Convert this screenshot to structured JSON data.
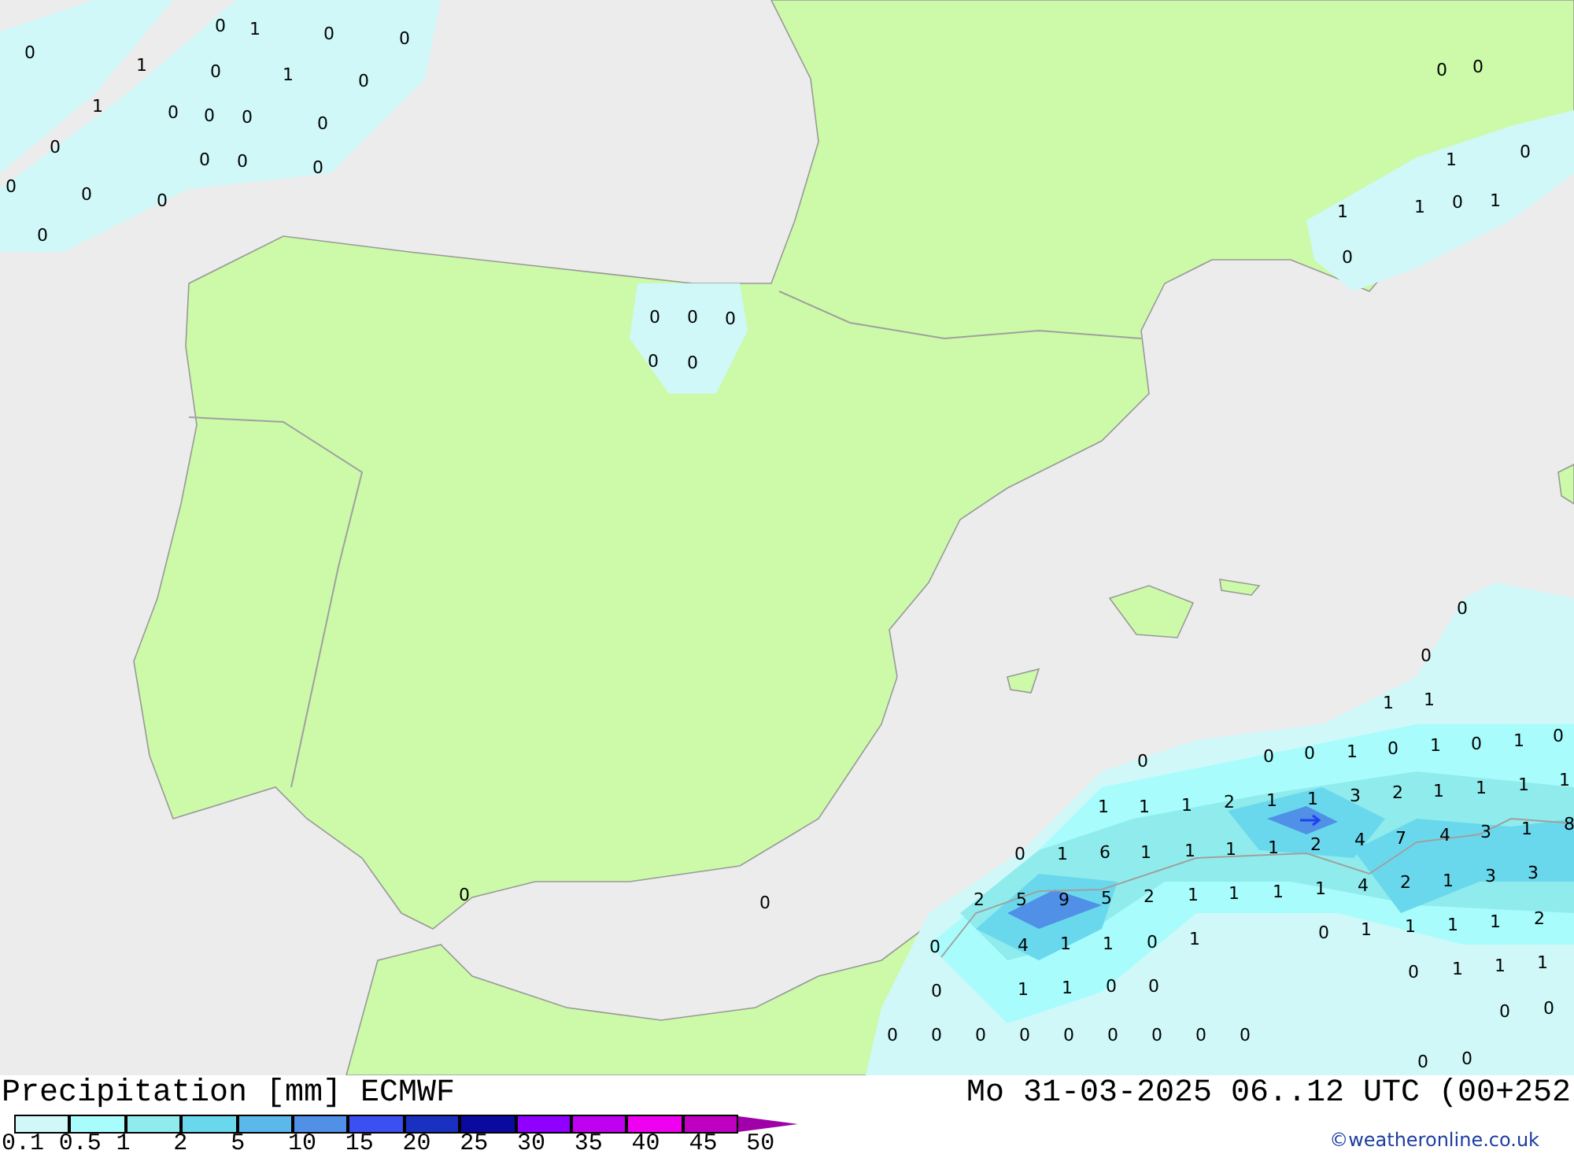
{
  "map": {
    "precipitation_labels": [
      "0",
      "0",
      "1",
      "0",
      "0",
      "1",
      "0",
      "1",
      "0",
      "1",
      "0",
      "0",
      "0",
      "0",
      "0",
      "0",
      "0",
      "0",
      "0",
      "0",
      "0",
      "0",
      "0",
      "0",
      "0",
      "0",
      "0",
      "0",
      "0",
      "1",
      "0",
      "1",
      "1",
      "0",
      "1",
      "0",
      "0",
      "0",
      "0",
      "0",
      "1",
      "1",
      "0",
      "0",
      "0",
      "1",
      "0",
      "1",
      "0",
      "1",
      "0",
      "1",
      "1",
      "1",
      "2",
      "1",
      "1",
      "3",
      "2",
      "1",
      "1",
      "1",
      "1",
      "0",
      "1",
      "6",
      "1",
      "1",
      "1",
      "1",
      "2",
      "4",
      "7",
      "4",
      "3",
      "1",
      "8",
      "2",
      "5",
      "9",
      "5",
      "2",
      "1",
      "1",
      "1",
      "1",
      "4",
      "2",
      "1",
      "3",
      "3",
      "0",
      "4",
      "1",
      "1",
      "0",
      "1",
      "0",
      "1",
      "1",
      "1",
      "1",
      "2",
      "0",
      "1",
      "1",
      "0",
      "0",
      "0",
      "1",
      "1",
      "1",
      "0",
      "0",
      "0",
      "0",
      "0",
      "0",
      "0",
      "0",
      "0",
      "0",
      "0",
      "0",
      "0"
    ]
  },
  "legend": {
    "title": "Precipitation [mm]",
    "model": "ECMWF",
    "bins": [
      {
        "kind": "box",
        "color": "#d0f8f8"
      },
      {
        "kind": "box",
        "color": "#a8fcfc"
      },
      {
        "kind": "box",
        "color": "#90ecec"
      },
      {
        "kind": "box",
        "color": "#6ad8ec"
      },
      {
        "kind": "box",
        "color": "#5ab8ea"
      },
      {
        "kind": "box",
        "color": "#5090e6"
      },
      {
        "kind": "box",
        "color": "#3a50f0"
      },
      {
        "kind": "box",
        "color": "#1a30c0"
      },
      {
        "kind": "box",
        "color": "#0a0aa0"
      },
      {
        "kind": "box",
        "color": "#9000ff"
      },
      {
        "kind": "box",
        "color": "#c000f0"
      },
      {
        "kind": "box",
        "color": "#f000f0"
      },
      {
        "kind": "box",
        "color": "#c000c0"
      },
      {
        "kind": "arrow",
        "color": "#a000a8"
      }
    ],
    "labels": [
      "0.1",
      "0.5",
      "1",
      "2",
      "5",
      "10",
      "15",
      "20",
      "25",
      "30",
      "35",
      "40",
      "45",
      "50"
    ]
  },
  "valid_time": "Mo 31-03-2025 06..12 UTC (00+252",
  "credit": "©weatheronline.co.uk"
}
